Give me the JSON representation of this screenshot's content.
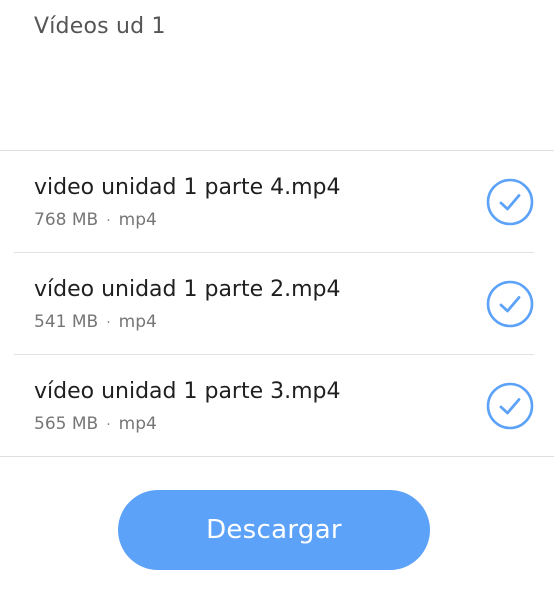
{
  "header": {
    "title": "Vídeos ud 1"
  },
  "files": [
    {
      "name": "video unidad 1 parte 4.mp4",
      "size": "768 MB",
      "separator": "·",
      "type": "mp4",
      "selected": true
    },
    {
      "name": "vídeo unidad 1 parte 2.mp4",
      "size": "541 MB",
      "separator": "·",
      "type": "mp4",
      "selected": true
    },
    {
      "name": "vídeo unidad 1 parte 3.mp4",
      "size": "565 MB",
      "separator": "·",
      "type": "mp4",
      "selected": true
    }
  ],
  "icons": {
    "check": "check-circle-icon"
  },
  "colors": {
    "accent": "#5ca2f8",
    "check": "#5ca2f8"
  },
  "footer": {
    "download_label": "Descargar"
  }
}
